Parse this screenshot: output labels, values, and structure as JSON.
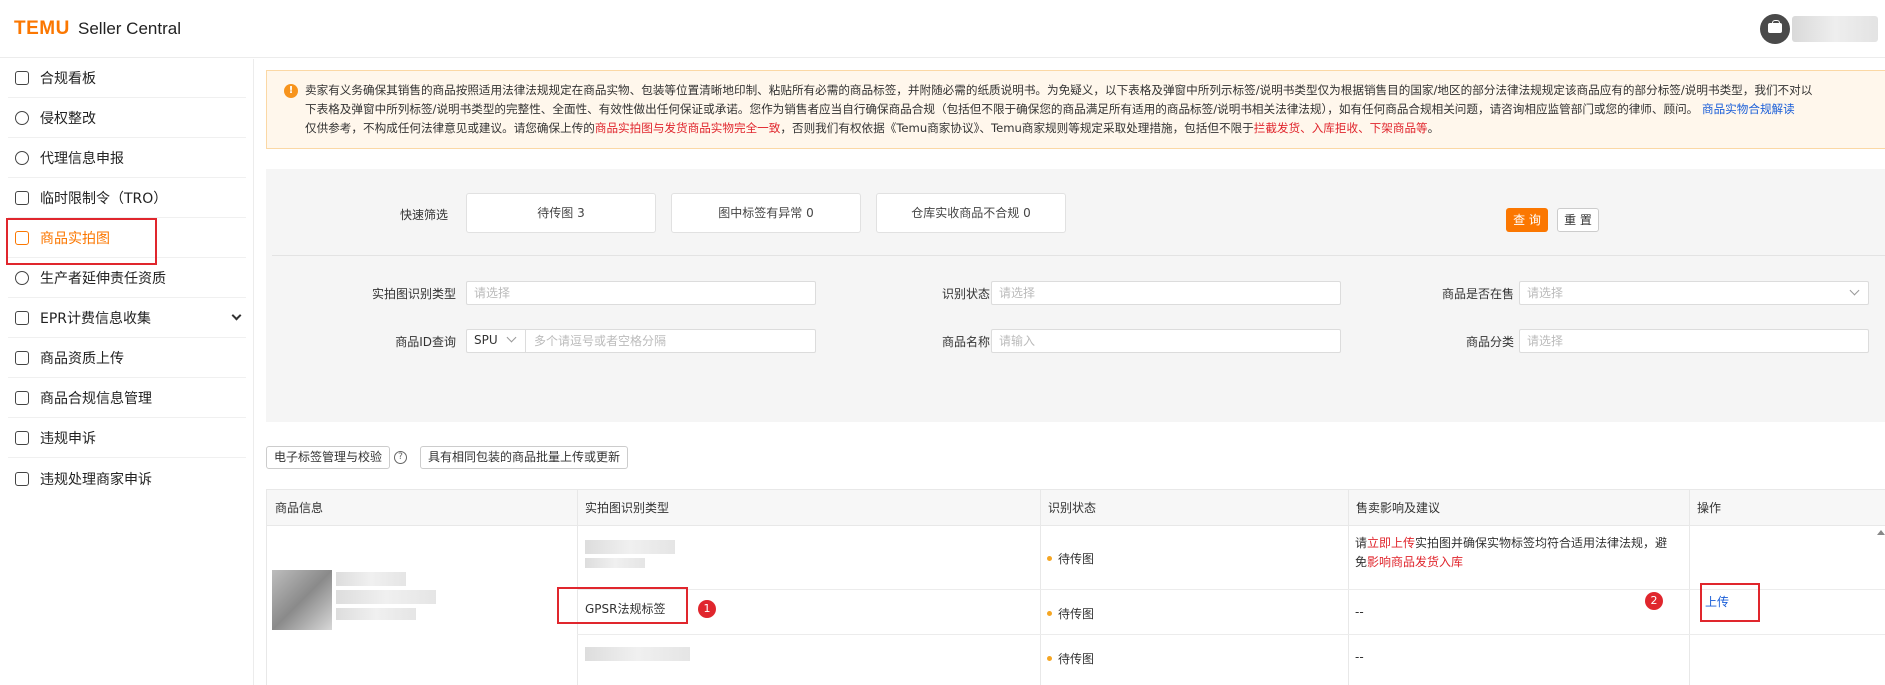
{
  "header": {
    "logo": "TEMU",
    "logo_sub": "Seller Central"
  },
  "sidebar": {
    "items": [
      {
        "label": "合规看板",
        "icon": "chart-line-icon"
      },
      {
        "label": "侵权整改",
        "icon": "alert-circle-icon"
      },
      {
        "label": "代理信息申报",
        "icon": "user-icon"
      },
      {
        "label": "临时限制令（TRO）",
        "icon": "calendar-icon"
      },
      {
        "label": "商品实拍图",
        "icon": "camera-bag-icon",
        "active": true
      },
      {
        "label": "生产者延伸责任资质",
        "icon": "badge-icon"
      },
      {
        "label": "EPR计费信息收集",
        "icon": "epr-icon",
        "expandable": true
      },
      {
        "label": "商品资质上传",
        "icon": "upload-box-icon"
      },
      {
        "label": "商品合规信息管理",
        "icon": "file-info-icon"
      },
      {
        "label": "违规申诉",
        "icon": "appeal-icon"
      },
      {
        "label": "违规处理商家申诉",
        "icon": "store-appeal-icon"
      }
    ]
  },
  "notice": {
    "l1": "卖家有义务确保其销售的商品按照适用法律法规规定在商品实物、包装等位置清晰地印制、粘贴所有必需的商品标签，并附随必需的纸质说明书。为免疑义，以下表格及弹窗中所列示标签/说明书类型仅为根据销售目的国家/地区的部分法律法规规定该商品应有的部分标签/说明书类型，我们不对以",
    "l2a": "下表格及弹窗中所列标签/说明书类型的完整性、全面性、有效性做出任何保证或承诺。您作为销售者应当自行确保商品合规（包括但不限于确保您的商品满足所有适用的商品标签/说明书相关法律法规），如有任何商品合规相关问题，请咨询相应监管部门或您的律师、顾问。",
    "l2b": "商品实物合规解读",
    "l3a": "仅供参考，不构成任何法律意见或建议。请您确保上传的",
    "l3b": "商品实拍图与发货商品实物完全一致",
    "l3c": "，否则我们有权依据《Temu商家协议》、Temu商家规则等规定采取处理措施，包括但不限于",
    "l3d": "拦截发货、入库拒收、下架商品等",
    "l3e": "。"
  },
  "filter": {
    "quick_label": "快速筛选",
    "quick": [
      "待传图 3",
      "图中标签有异常 0",
      "仓库实收商品不合规 0"
    ],
    "type_label": "实拍图识别类型",
    "type_placeholder": "请选择",
    "status_label": "识别状态",
    "status_placeholder": "请选择",
    "onsale_label": "商品是否在售",
    "onsale_placeholder": "请选择",
    "id_label": "商品ID查询",
    "id_mode": "SPU",
    "id_placeholder": "多个请逗号或者空格分隔",
    "name_label": "商品名称",
    "name_placeholder": "请输入",
    "cat_label": "商品分类",
    "cat_placeholder": "请选择",
    "query": "查 询",
    "reset": "重 置"
  },
  "toolbar": {
    "label_mgmt": "电子标签管理与校验",
    "batch": "具有相同包装的商品批量上传或更新"
  },
  "table": {
    "columns": [
      "商品信息",
      "实拍图识别类型",
      "识别状态",
      "售卖影响及建议",
      "操作"
    ],
    "rows": [
      {
        "type": "",
        "status": "待传图",
        "advice": "",
        "action": ""
      },
      {
        "type": "GPSR法规标签",
        "status": "待传图",
        "advice": "--",
        "action": "上传"
      },
      {
        "type": "",
        "status": "待传图",
        "advice": "--",
        "action": ""
      }
    ],
    "advice_1a": "请",
    "advice_1b": "立即上传",
    "advice_1c": "实拍图并确保实物标签均符合适用法律法规，避",
    "advice_1d": "免",
    "advice_1e": "影响商品发货入库"
  },
  "badges": [
    "1",
    "2"
  ]
}
